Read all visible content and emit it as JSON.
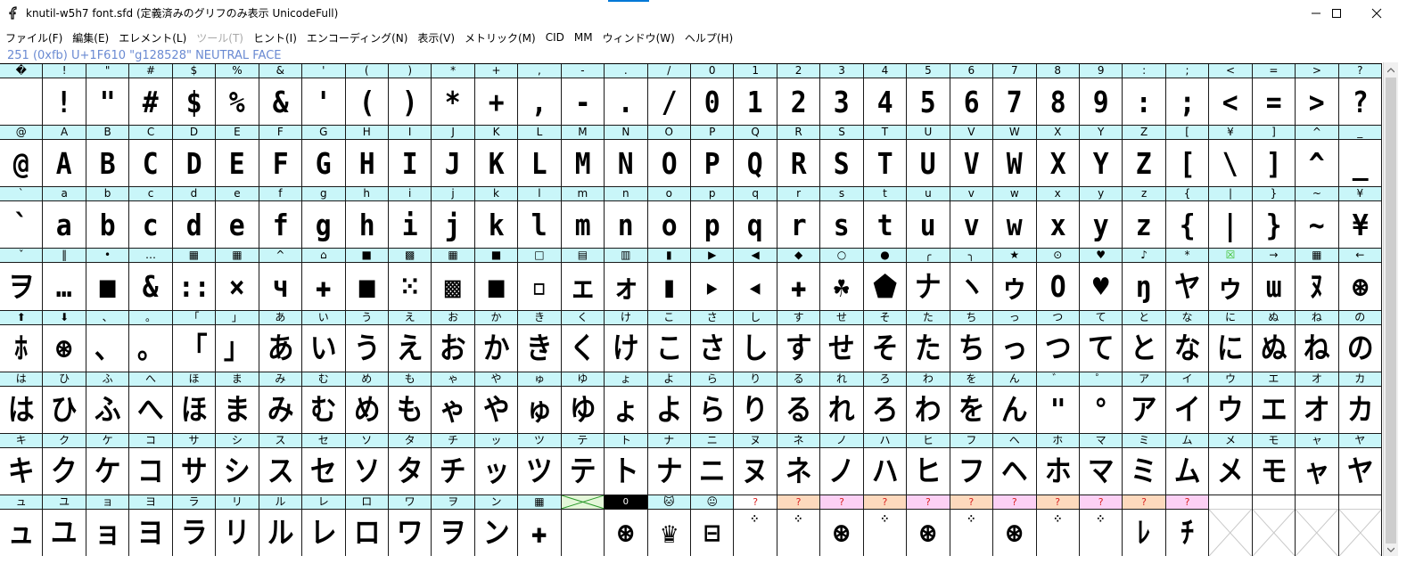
{
  "window": {
    "title": "knutil-w5h7 font.sfd (定義済みのグリフのみ表示 UnicodeFull)",
    "controls": {
      "minimize": "minimize",
      "maximize": "maximize",
      "close": "close"
    }
  },
  "menu": [
    {
      "label": "ファイル(F)",
      "disabled": false
    },
    {
      "label": "編集(E)",
      "disabled": false
    },
    {
      "label": "エレメント(L)",
      "disabled": false
    },
    {
      "label": "ツール(T)",
      "disabled": true
    },
    {
      "label": "ヒント(I)",
      "disabled": false
    },
    {
      "label": "エンコーディング(N)",
      "disabled": false
    },
    {
      "label": "表示(V)",
      "disabled": false
    },
    {
      "label": "メトリック(M)",
      "disabled": false
    },
    {
      "label": "CID",
      "disabled": false
    },
    {
      "label": "MM",
      "disabled": false
    },
    {
      "label": "ウィンドウ(W)",
      "disabled": false
    },
    {
      "label": "ヘルプ(H)",
      "disabled": false
    }
  ],
  "info_line": "251 (0xfb) U+1F610 \"g128528\" NEUTRAL FACE",
  "colors": {
    "label_bg": "#c9f6f9",
    "info_text": "#6a8ad2",
    "question_mark": "#d92020",
    "peach": "#fdd9bd",
    "pink": "#fcd0f4",
    "green_box": "#3cc02a"
  },
  "grid": {
    "rows": [
      {
        "labels": [
          "�",
          "!",
          "\"",
          "#",
          "$",
          "%",
          "&",
          "'",
          "(",
          ")",
          "*",
          "+",
          ",",
          "-",
          ".",
          "/",
          "0",
          "1",
          "2",
          "3",
          "4",
          "5",
          "6",
          "7",
          "8",
          "9",
          ":",
          ";",
          "<",
          "=",
          ">",
          "?"
        ],
        "glyphs": [
          "",
          "!",
          "\"",
          "#",
          "$",
          "%",
          "&",
          "'",
          "(",
          ")",
          "*",
          "+",
          ",",
          "-",
          ".",
          "/",
          "0",
          "1",
          "2",
          "3",
          "4",
          "5",
          "6",
          "7",
          "8",
          "9",
          ":",
          ";",
          "<",
          "=",
          ">",
          "?"
        ]
      },
      {
        "labels": [
          "@",
          "A",
          "B",
          "C",
          "D",
          "E",
          "F",
          "G",
          "H",
          "I",
          "J",
          "K",
          "L",
          "M",
          "N",
          "O",
          "P",
          "Q",
          "R",
          "S",
          "T",
          "U",
          "V",
          "W",
          "X",
          "Y",
          "Z",
          "[",
          "¥",
          "]",
          "^",
          "_"
        ],
        "glyphs": [
          "@",
          "A",
          "B",
          "C",
          "D",
          "E",
          "F",
          "G",
          "H",
          "I",
          "J",
          "K",
          "L",
          "M",
          "N",
          "O",
          "P",
          "Q",
          "R",
          "S",
          "T",
          "U",
          "V",
          "W",
          "X",
          "Y",
          "Z",
          "[",
          "\\",
          "]",
          "^",
          "_"
        ]
      },
      {
        "labels": [
          "`",
          "a",
          "b",
          "c",
          "d",
          "e",
          "f",
          "g",
          "h",
          "i",
          "j",
          "k",
          "l",
          "m",
          "n",
          "o",
          "p",
          "q",
          "r",
          "s",
          "t",
          "u",
          "v",
          "w",
          "x",
          "y",
          "z",
          "{",
          "|",
          "}",
          "~",
          "¥"
        ],
        "glyphs": [
          "`",
          "a",
          "b",
          "c",
          "d",
          "e",
          "f",
          "g",
          "h",
          "i",
          "j",
          "k",
          "l",
          "m",
          "n",
          "o",
          "p",
          "q",
          "r",
          "s",
          "t",
          "u",
          "v",
          "w",
          "x",
          "y",
          "z",
          "{",
          "|",
          "}",
          "~",
          "¥"
        ]
      },
      {
        "labels": [
          "ˇ",
          "‖",
          "•",
          "…",
          "▦",
          "▦",
          "^",
          "⌂",
          "■",
          "▩",
          "▦",
          "■",
          "□",
          "▤",
          "▥",
          "▮",
          "▶",
          "◀",
          "◆",
          "○",
          "●",
          "╭",
          "╮",
          "★",
          "⊙",
          "♥",
          "♪",
          "*",
          "☒",
          "→",
          "▦",
          "←"
        ],
        "glyphs": [
          "ヲ",
          "…",
          "■",
          "&",
          "::",
          "×",
          "ч",
          "✚",
          "■",
          "⁙",
          "▩",
          "■",
          "▫",
          "ェ",
          "ォ",
          "▮",
          "▸",
          "◂",
          "✚",
          "☘",
          "⬟",
          "ナ",
          "ヽ",
          "ゥ",
          "O",
          "♥",
          "ŋ",
          "ヤ",
          "ゥ",
          "ɯ",
          "ﾇ",
          "⊛"
        ]
      },
      {
        "labels": [
          "⬆",
          "⬇",
          "、",
          "。",
          "「",
          "」",
          "あ",
          "い",
          "う",
          "え",
          "お",
          "か",
          "き",
          "く",
          "け",
          "こ",
          "さ",
          "し",
          "す",
          "せ",
          "そ",
          "た",
          "ち",
          "っ",
          "つ",
          "て",
          "と",
          "な",
          "に",
          "ぬ",
          "ね",
          "の"
        ],
        "glyphs": [
          "ﾎ",
          "⊛",
          "、",
          "。",
          "「",
          "」",
          "あ",
          "い",
          "う",
          "え",
          "お",
          "か",
          "き",
          "く",
          "け",
          "こ",
          "さ",
          "し",
          "す",
          "せ",
          "そ",
          "た",
          "ち",
          "っ",
          "つ",
          "て",
          "と",
          "な",
          "に",
          "ぬ",
          "ね",
          "の"
        ]
      },
      {
        "labels": [
          "は",
          "ひ",
          "ふ",
          "へ",
          "ほ",
          "ま",
          "み",
          "む",
          "め",
          "も",
          "ゃ",
          "や",
          "ゅ",
          "ゆ",
          "ょ",
          "よ",
          "ら",
          "り",
          "る",
          "れ",
          "ろ",
          "わ",
          "を",
          "ん",
          "゛",
          "゜",
          "ア",
          "イ",
          "ウ",
          "エ",
          "オ",
          "カ"
        ],
        "glyphs": [
          "は",
          "ひ",
          "ふ",
          "へ",
          "ほ",
          "ま",
          "み",
          "む",
          "め",
          "も",
          "ゃ",
          "や",
          "ゅ",
          "ゆ",
          "ょ",
          "よ",
          "ら",
          "り",
          "る",
          "れ",
          "ろ",
          "わ",
          "を",
          "ん",
          "\"",
          "°",
          "ア",
          "イ",
          "ウ",
          "エ",
          "オ",
          "カ"
        ]
      },
      {
        "labels": [
          "キ",
          "ク",
          "ケ",
          "コ",
          "サ",
          "シ",
          "ス",
          "セ",
          "ソ",
          "タ",
          "チ",
          "ッ",
          "ツ",
          "テ",
          "ト",
          "ナ",
          "ニ",
          "ヌ",
          "ネ",
          "ノ",
          "ハ",
          "ヒ",
          "フ",
          "ヘ",
          "ホ",
          "マ",
          "ミ",
          "ム",
          "メ",
          "モ",
          "ャ",
          "ヤ"
        ],
        "glyphs": [
          "キ",
          "ク",
          "ケ",
          "コ",
          "サ",
          "シ",
          "ス",
          "セ",
          "ソ",
          "タ",
          "チ",
          "ッ",
          "ツ",
          "テ",
          "ト",
          "ナ",
          "ニ",
          "ヌ",
          "ネ",
          "ノ",
          "ハ",
          "ヒ",
          "フ",
          "ヘ",
          "ホ",
          "マ",
          "ミ",
          "ム",
          "メ",
          "モ",
          "ャ",
          "ヤ"
        ]
      },
      {
        "labels": [
          "ュ",
          "ユ",
          "ョ",
          "ヨ",
          "ラ",
          "リ",
          "ル",
          "レ",
          "ロ",
          "ワ",
          "ヲ",
          "ン",
          "▦",
          "",
          "0",
          "🐱",
          "😐",
          "?",
          "?",
          "?",
          "?",
          "?",
          "?",
          "?",
          "?",
          "?",
          "?",
          "?",
          "",
          "",
          "",
          ""
        ],
        "glyphs": [
          "ュ",
          "ユ",
          "ョ",
          "ヨ",
          "ラ",
          "リ",
          "ル",
          "レ",
          "ロ",
          "ワ",
          "ヲ",
          "ン",
          "✚",
          "",
          "⊛",
          "♛",
          "⊟",
          "⁘",
          "⁘",
          "⊛",
          "⁘",
          "⊛",
          "⁘",
          "⊛",
          "⁘",
          "⁘",
          "ﾚ",
          "ﾁ",
          "",
          "",
          "",
          ""
        ]
      }
    ]
  }
}
